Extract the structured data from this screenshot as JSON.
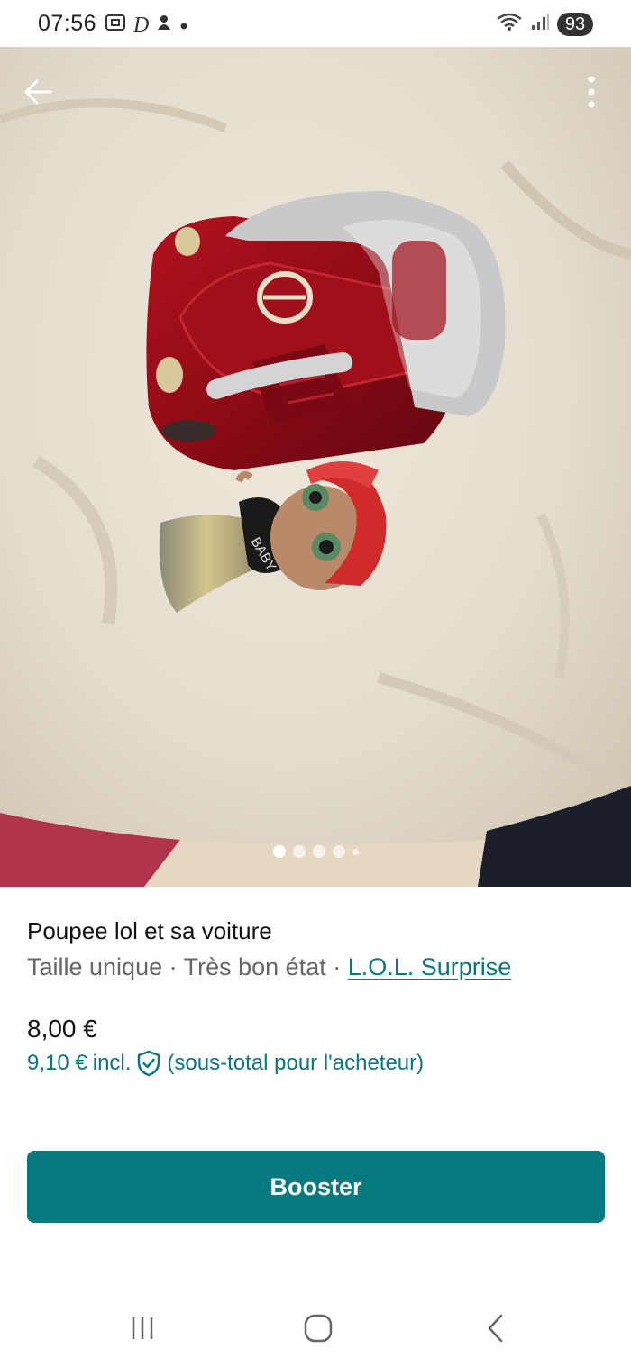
{
  "status_bar": {
    "time": "07:56",
    "battery": "93",
    "icons": [
      "screenshot-icon",
      "d-app-icon",
      "notification-icon",
      "dot-icon",
      "wifi-icon",
      "signal-icon"
    ]
  },
  "photo": {
    "page_count": 5,
    "active_page": 1
  },
  "item": {
    "title": "Poupee lol et sa voiture",
    "size": "Taille unique",
    "separator": " · ",
    "condition": "Très bon état",
    "brand": "L.O.L. Surprise",
    "price": "8,00 €",
    "price_incl": "9,10 €",
    "incl_label": "incl.",
    "subtotal_note": "(sous-total pour l'acheteur)"
  },
  "actions": {
    "booster_label": "Booster"
  },
  "colors": {
    "accent": "#077a80",
    "link": "#0b7680"
  }
}
